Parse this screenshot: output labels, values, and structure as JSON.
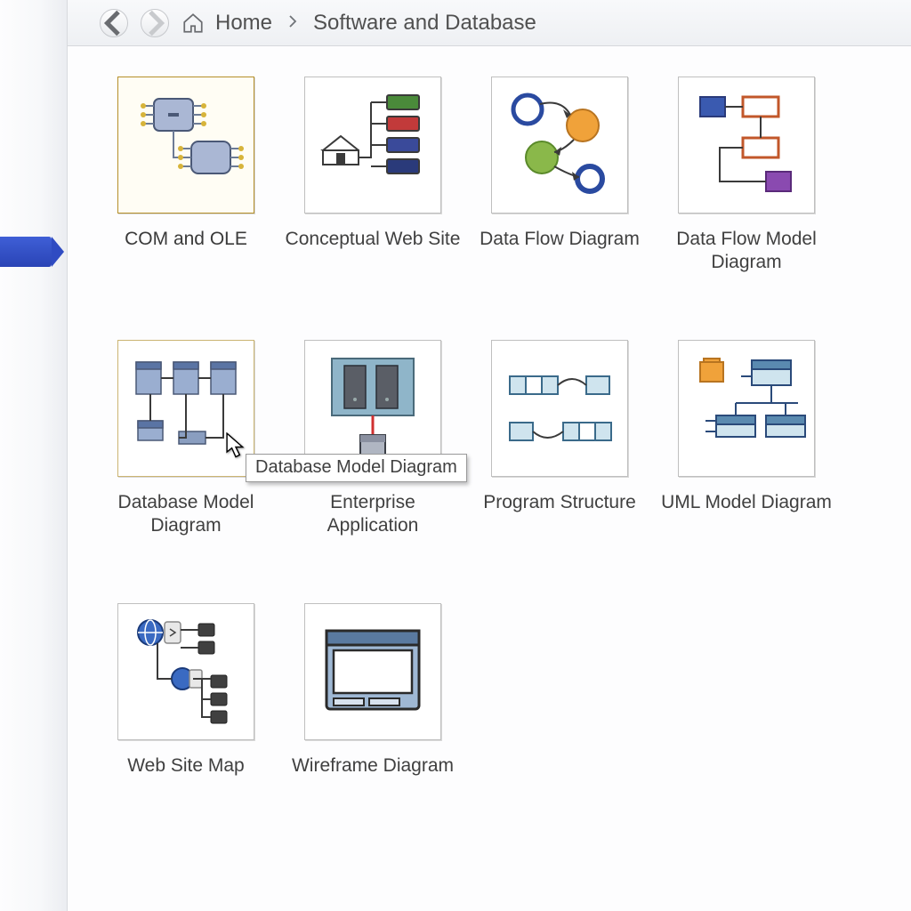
{
  "breadcrumb": {
    "home_label": "Home",
    "current": "Software and Database"
  },
  "templates": [
    {
      "id": "com-and-ole",
      "label": "COM and OLE"
    },
    {
      "id": "conceptual-web-site",
      "label": "Conceptual Web Site"
    },
    {
      "id": "data-flow-diagram",
      "label": "Data Flow Diagram"
    },
    {
      "id": "data-flow-model-diagram",
      "label": "Data Flow Model Diagram"
    },
    {
      "id": "database-model-diagram",
      "label": "Database Model Diagram"
    },
    {
      "id": "enterprise-application",
      "label": "Enterprise Application"
    },
    {
      "id": "program-structure",
      "label": "Program Structure"
    },
    {
      "id": "uml-model-diagram",
      "label": "UML Model Diagram"
    },
    {
      "id": "web-site-map",
      "label": "Web Site Map"
    },
    {
      "id": "wireframe-diagram",
      "label": "Wireframe Diagram"
    }
  ],
  "tooltip_text": "Database Model Diagram",
  "selected_id": "com-and-ole",
  "hover_id": "database-model-diagram"
}
